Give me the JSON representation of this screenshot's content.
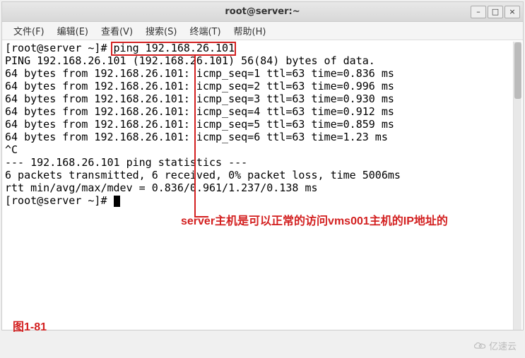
{
  "titlebar": {
    "title": "root@server:~"
  },
  "menu": {
    "file": "文件(F)",
    "edit": "编辑(E)",
    "view": "查看(V)",
    "search": "搜索(S)",
    "terminal": "终端(T)",
    "help": "帮助(H)"
  },
  "terminal": {
    "prompt1": "[root@server ~]# ",
    "command": "ping 192.168.26.101",
    "line1": "PING 192.168.26.101 (192.168.26.101) 56(84) bytes of data.",
    "line2": "64 bytes from 192.168.26.101: icmp_seq=1 ttl=63 time=0.836 ms",
    "line3": "64 bytes from 192.168.26.101: icmp_seq=2 ttl=63 time=0.996 ms",
    "line4": "64 bytes from 192.168.26.101: icmp_seq=3 ttl=63 time=0.930 ms",
    "line5": "64 bytes from 192.168.26.101: icmp_seq=4 ttl=63 time=0.912 ms",
    "line6": "64 bytes from 192.168.26.101: icmp_seq=5 ttl=63 time=0.859 ms",
    "line7": "64 bytes from 192.168.26.101: icmp_seq=6 ttl=63 time=1.23 ms",
    "line8": "^C",
    "line9": "--- 192.168.26.101 ping statistics ---",
    "line10": "6 packets transmitted, 6 received, 0% packet loss, time 5006ms",
    "line11": "rtt min/avg/max/mdev = 0.836/0.961/1.237/0.138 ms",
    "prompt2": "[root@server ~]# "
  },
  "annotation": "server主机是可以正常的访问vms001主机的IP地址的",
  "figure_label": "图1-81",
  "watermark": "亿速云"
}
